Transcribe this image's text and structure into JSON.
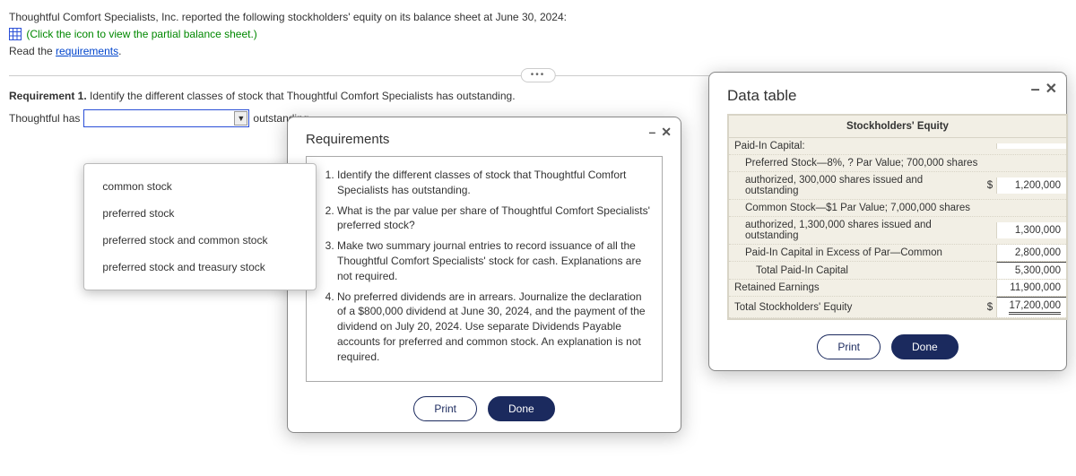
{
  "intro": {
    "line1": "Thoughtful Comfort Specialists, Inc. reported the following stockholders' equity on its balance sheet at June 30, 2024:",
    "icon_link": "(Click the icon to view the partial balance sheet.)",
    "read_prefix": "Read the ",
    "requirements_link": "requirements",
    "period": "."
  },
  "requirement1": {
    "title_bold": "Requirement 1.",
    "title_rest": " Identify the different classes of stock that Thoughtful Comfort Specialists has outstanding.",
    "before": "Thoughtful has",
    "after": "outstanding."
  },
  "dropdown": {
    "options": [
      "common stock",
      "preferred stock",
      "preferred stock and common stock",
      "preferred stock and treasury stock"
    ]
  },
  "requirements_popup": {
    "title": "Requirements",
    "items": [
      "Identify the different classes of stock that Thoughtful Comfort Specialists has outstanding.",
      "What is the par value per share of Thoughtful Comfort Specialists' preferred stock?",
      "Make two summary journal entries to record issuance of all the Thoughtful Comfort Specialists' stock for cash. Explanations are not required.",
      "No preferred dividends are in arrears. Journalize the declaration of a $800,000 dividend at June 30, 2024, and the payment of the dividend on July 20, 2024. Use separate Dividends Payable accounts for preferred and common stock. An explanation is not required."
    ],
    "print": "Print",
    "done": "Done"
  },
  "data_popup": {
    "title": "Data table",
    "heading": "Stockholders' Equity",
    "rows": {
      "paid_in_capital": "Paid-In Capital:",
      "preferred_a": "Preferred Stock—8%, ? Par Value; 700,000 shares",
      "preferred_b": "authorized, 300,000 shares issued and outstanding",
      "preferred_amt": "1,200,000",
      "common_a": "Common Stock—$1 Par Value; 7,000,000 shares",
      "common_b": "authorized, 1,300,000 shares issued and outstanding",
      "common_amt": "1,300,000",
      "apic": "Paid-In Capital in Excess of Par—Common",
      "apic_amt": "2,800,000",
      "total_pic": "Total Paid-In Capital",
      "total_pic_amt": "5,300,000",
      "re": "Retained Earnings",
      "re_amt": "11,900,000",
      "tse": "Total Stockholders' Equity",
      "tse_amt": "17,200,000",
      "dollar": "$"
    },
    "print": "Print",
    "done": "Done"
  }
}
